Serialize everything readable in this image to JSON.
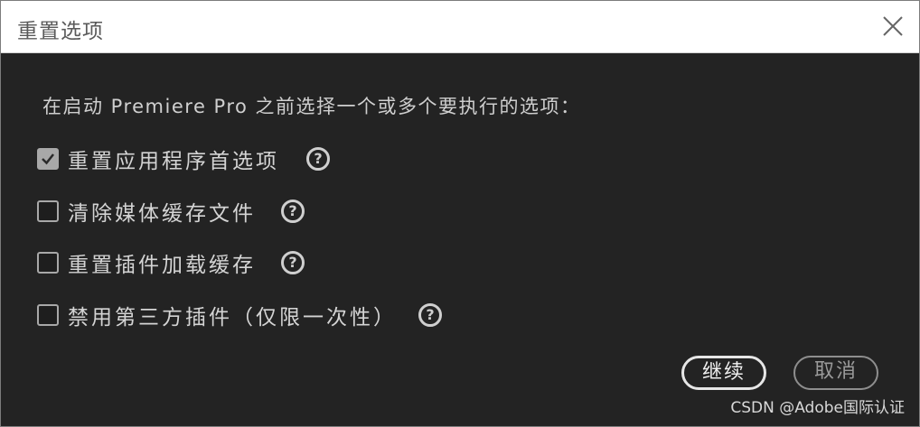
{
  "window": {
    "title": "重置选项"
  },
  "prompt": "在启动 Premiere Pro 之前选择一个或多个要执行的选项：",
  "options": [
    {
      "label": "重置应用程序首选项",
      "checked": true
    },
    {
      "label": "清除媒体缓存文件",
      "checked": false
    },
    {
      "label": "重置插件加载缓存",
      "checked": false
    },
    {
      "label": "禁用第三方插件（仅限一次性）",
      "checked": false
    }
  ],
  "help_icon_glyph": "?",
  "buttons": {
    "continue": "继续",
    "cancel": "取消"
  },
  "watermark": "CSDN @Adobe国际认证",
  "colors": {
    "background": "#232323",
    "titlebar": "#ffffff",
    "text": "#d4d4d4"
  }
}
